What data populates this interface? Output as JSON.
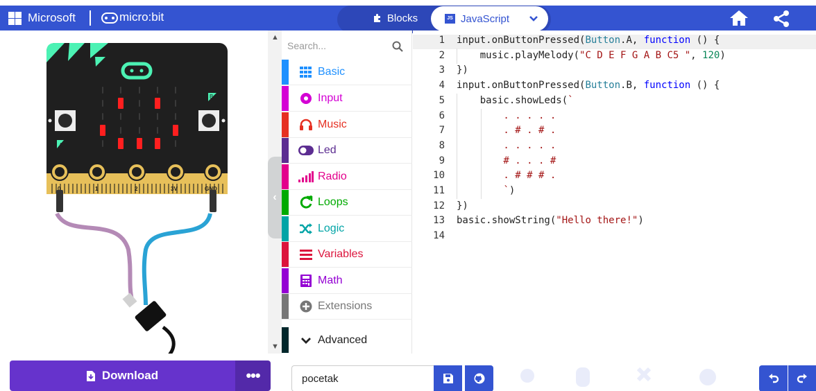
{
  "header": {
    "brand": "Microsoft",
    "product": "micro:bit",
    "tabs": [
      {
        "label": "Blocks",
        "icon": "puzzle-icon",
        "active": false
      },
      {
        "label": "JavaScript",
        "icon": "js-icon",
        "active": true,
        "badge": "JS"
      }
    ],
    "colors": {
      "header_bg": "#3454d1",
      "tab_group_bg": "#2d47b8"
    }
  },
  "simulator": {
    "pins": [
      "0",
      "1",
      "2",
      "3V",
      "GND"
    ],
    "button_labels": [
      "A",
      "B"
    ],
    "led_matrix": [
      ".....",
      ".#.#.",
      ".....",
      "#...#",
      ".###."
    ],
    "colors": {
      "board": "#1f1f1f",
      "accent": "#4cf2b4",
      "led_on": "#ff1f1f",
      "pad": "#e7c05a"
    }
  },
  "toolbox": {
    "search_placeholder": "Search...",
    "categories": [
      {
        "label": "Basic",
        "color": "#1e90ff",
        "icon": "grid-icon"
      },
      {
        "label": "Input",
        "color": "#d400d4",
        "icon": "input-target-icon"
      },
      {
        "label": "Music",
        "color": "#e63022",
        "icon": "headphones-icon"
      },
      {
        "label": "Led",
        "color": "#5c2d91",
        "icon": "toggle-icon"
      },
      {
        "label": "Radio",
        "color": "#e3008c",
        "icon": "signal-bars-icon"
      },
      {
        "label": "Loops",
        "color": "#00aa00",
        "icon": "loop-arrow-icon"
      },
      {
        "label": "Logic",
        "color": "#00a4a6",
        "icon": "shuffle-icon"
      },
      {
        "label": "Variables",
        "color": "#dc143c",
        "icon": "list-icon"
      },
      {
        "label": "Math",
        "color": "#9400d3",
        "icon": "calculator-icon"
      },
      {
        "label": "Extensions",
        "color": "#777777",
        "icon": "plus-circle-icon"
      },
      {
        "label": "Advanced",
        "color": "#00272b",
        "icon": "chevron-down-icon"
      }
    ]
  },
  "editor": {
    "lines": [
      {
        "n": "1",
        "code": "input.onButtonPressed(Button.A, function () {"
      },
      {
        "n": "2",
        "code": "    music.playMelody(\"C D E F G A B C5 \", 120)"
      },
      {
        "n": "3",
        "code": "})"
      },
      {
        "n": "4",
        "code": "input.onButtonPressed(Button.B, function () {"
      },
      {
        "n": "5",
        "code": "    basic.showLeds(`"
      },
      {
        "n": "6",
        "code": "        . . . . ."
      },
      {
        "n": "7",
        "code": "        . # . # ."
      },
      {
        "n": "8",
        "code": "        . . . . ."
      },
      {
        "n": "9",
        "code": "        # . . . #"
      },
      {
        "n": "10",
        "code": "        . # # # ."
      },
      {
        "n": "11",
        "code": "        `)"
      },
      {
        "n": "12",
        "code": "})"
      },
      {
        "n": "13",
        "code": "basic.showString(\"Hello there!\")"
      },
      {
        "n": "14",
        "code": ""
      }
    ]
  },
  "footer": {
    "download_label": "Download",
    "more_label": "•••",
    "project_name": "pocetak",
    "colors": {
      "download": "#6633cc",
      "download_dark": "#5329a9",
      "accent": "#3454d1"
    }
  }
}
